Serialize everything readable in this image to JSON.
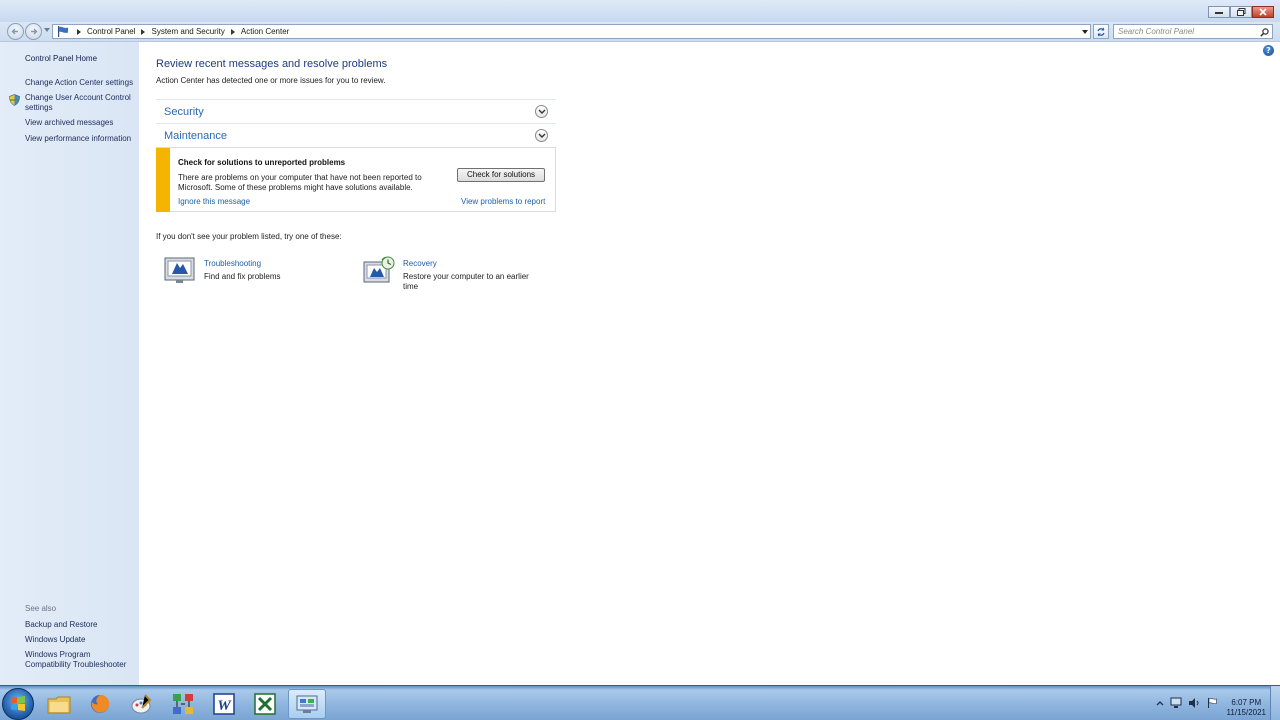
{
  "address": {
    "crumbs": [
      "Control Panel",
      "System and Security",
      "Action Center"
    ],
    "search_placeholder": "Search Control Panel"
  },
  "sidebar": {
    "home": "Control Panel Home",
    "links": [
      "Change Action Center settings",
      "Change User Account Control settings",
      "View archived messages",
      "View performance information"
    ],
    "see_also_label": "See also",
    "see_also": [
      "Backup and Restore",
      "Windows Update",
      "Windows Program Compatibility Troubleshooter"
    ]
  },
  "main": {
    "title": "Review recent messages and resolve problems",
    "subtitle": "Action Center has detected one or more issues for you to review.",
    "sections": [
      "Security",
      "Maintenance"
    ],
    "message": {
      "title": "Check for solutions to unreported problems",
      "text": "There are problems on your computer that have not been reported to Microsoft. Some of these problems might have solutions available.",
      "button": "Check for solutions",
      "ignore_link": "Ignore this message",
      "view_link": "View problems to report",
      "accent_color": "#f4b400"
    },
    "try_line": "If you don't see your problem listed, try one of these:",
    "tools": [
      {
        "link": "Troubleshooting",
        "desc": "Find and fix problems",
        "icon": "troubleshooting-icon"
      },
      {
        "link": "Recovery",
        "desc": "Restore your computer to an earlier time",
        "icon": "recovery-icon"
      }
    ]
  },
  "taskbar": {
    "apps": [
      "file-explorer-icon",
      "firefox-icon",
      "paint-icon",
      "network-app-icon",
      "word-icon",
      "excel-icon",
      "control-panel-icon"
    ],
    "clock_time": "6:07 PM",
    "clock_date": "11/15/2021"
  }
}
